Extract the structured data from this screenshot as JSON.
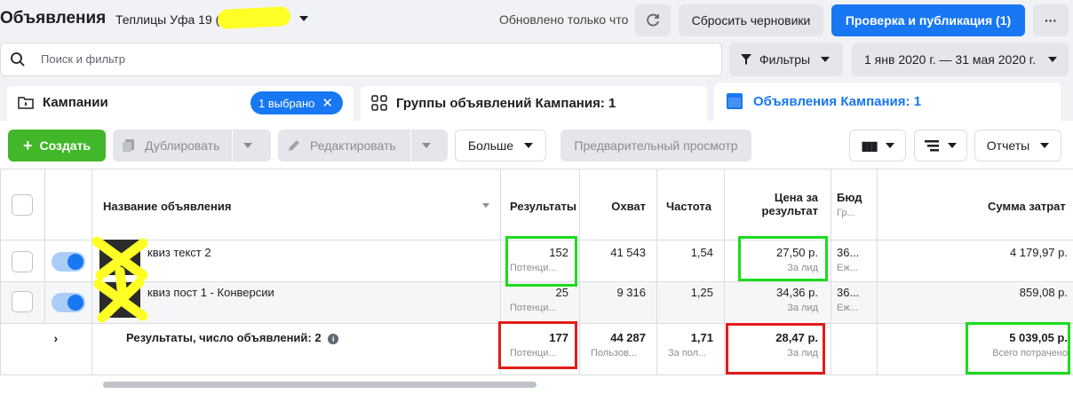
{
  "header": {
    "title": "Объявления",
    "account": "Теплицы Уфа 19 (",
    "updated": "Обновлено только что",
    "reset_drafts": "Сбросить черновики",
    "publish": "Проверка и публикация (1)",
    "more": "···"
  },
  "search": {
    "placeholder": "Поиск и фильтр"
  },
  "filters": {
    "label": "Фильтры",
    "date_range": "1 янв 2020 г. — 31 мая 2020 г."
  },
  "tabs": {
    "campaigns": {
      "label": "Кампании",
      "chip": "1 выбрано"
    },
    "ad_sets": {
      "label": "Группы объявлений Кампания: 1"
    },
    "ads": {
      "label": "Объявления Кампания: 1"
    }
  },
  "toolbar": {
    "create": "Создать",
    "duplicate": "Дублировать",
    "edit": "Редактировать",
    "more": "Больше",
    "preview": "Предварительный просмотр",
    "reports": "Отчеты"
  },
  "table": {
    "headers": {
      "name": "Название объявления",
      "results": "Результаты",
      "reach": "Охват",
      "frequency": "Частота",
      "cost_per_result_1": "Цена за",
      "cost_per_result_2": "результат",
      "budget": "Бюд",
      "budget_sub": "Гр...",
      "amount_spent": "Сумма затрат"
    },
    "rows": [
      {
        "name": "квиз текст 2",
        "results": "152",
        "results_sub": "Потенци...",
        "reach": "41 543",
        "frequency": "1,54",
        "cost": "27,50 р.",
        "cost_sub": "За лид",
        "budget": "36...",
        "budget_sub": "Еж...",
        "spent": "4 179,97 р."
      },
      {
        "name": "квиз пост 1 - Конверсии",
        "results": "25",
        "results_sub": "Потенци...",
        "reach": "9 316",
        "frequency": "1,25",
        "cost": "34,36 р.",
        "cost_sub": "За лид",
        "budget": "36...",
        "budget_sub": "Еж...",
        "spent": "859,08 р."
      }
    ],
    "totals": {
      "label": "Результаты, число объявлений: 2",
      "results": "177",
      "results_sub": "Потенци...",
      "reach": "44 287",
      "reach_sub": "Пользов...",
      "frequency": "1,71",
      "frequency_sub": "За пол...",
      "cost": "28,47 р.",
      "cost_sub": "За лид",
      "spent": "5 039,05 р.",
      "spent_sub": "Всего потрачено"
    }
  },
  "colors": {
    "accent": "#1877f2",
    "create": "#42b72a",
    "highlight_green": "#1bdc1b",
    "highlight_red": "#e41b1b",
    "marker_yellow": "#ffff26"
  }
}
